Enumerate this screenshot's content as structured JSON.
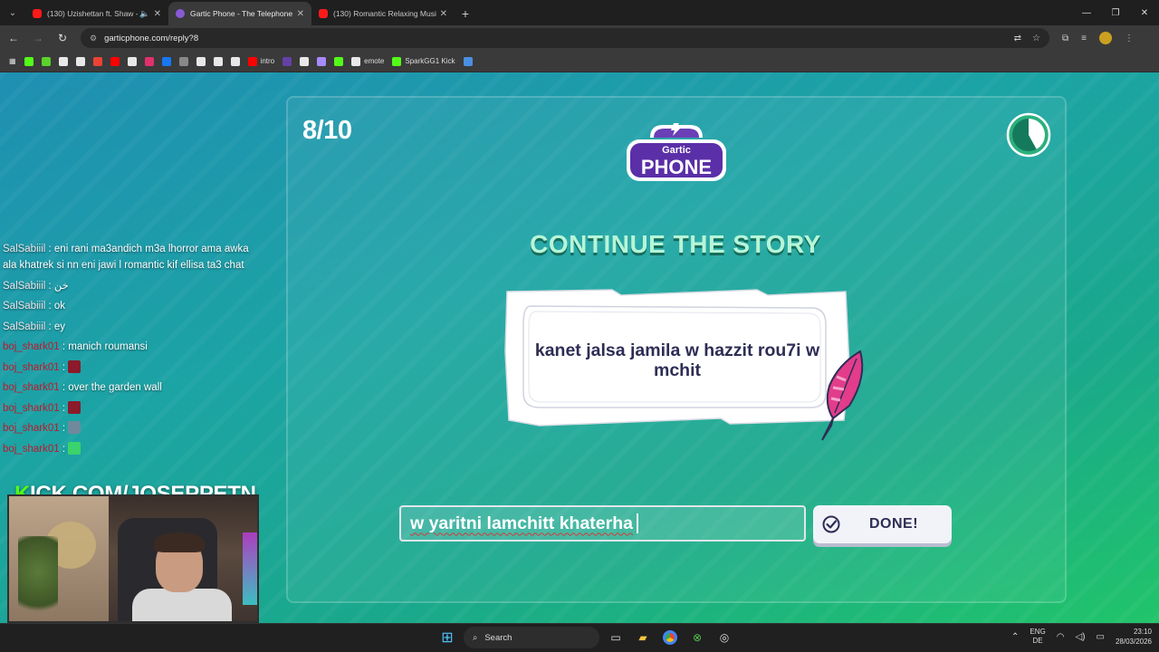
{
  "browser": {
    "tabs": [
      {
        "title": "(130) Uzishettan ft. Shaw - ",
        "favicon": "youtube-icon",
        "audio": true,
        "active": false
      },
      {
        "title": "Gartic Phone - The Telephone G",
        "favicon": "gartic-icon",
        "audio": false,
        "active": true
      },
      {
        "title": "(130) Romantic Relaxing Music",
        "favicon": "youtube-icon",
        "audio": false,
        "active": false
      }
    ],
    "url": "garticphone.com/reply?8",
    "bookmarks": [
      {
        "label": "",
        "icon": "kick-icon",
        "color": "#53fc18"
      },
      {
        "label": "",
        "icon": "d-icon",
        "color": "#5bd12b"
      },
      {
        "label": "",
        "icon": "diamond-icon",
        "color": "#e8e8e8"
      },
      {
        "label": "",
        "icon": "download-icon",
        "color": "#e8e8e8"
      },
      {
        "label": "",
        "icon": "gmail-icon",
        "color": "#ea4335"
      },
      {
        "label": "",
        "icon": "youtube-icon",
        "color": "#ff0000"
      },
      {
        "label": "",
        "icon": "tiktok-icon",
        "color": "#e8e8e8"
      },
      {
        "label": "",
        "icon": "instagram-icon",
        "color": "#e1306c"
      },
      {
        "label": "",
        "icon": "facebook-icon",
        "color": "#1877f2"
      },
      {
        "label": "",
        "icon": "gamepad-icon",
        "color": "#888888"
      },
      {
        "label": "",
        "icon": "star-icon",
        "color": "#e8e8e8"
      },
      {
        "label": "",
        "icon": "camera-icon",
        "color": "#e8e8e8"
      },
      {
        "label": "",
        "icon": "document-icon",
        "color": "#e8e8e8"
      },
      {
        "label": "intro",
        "icon": "youtube-icon",
        "color": "#ff0000"
      },
      {
        "label": "",
        "icon": "v-icon",
        "color": "#6441a5"
      },
      {
        "label": "",
        "icon": "p-icon",
        "color": "#e8e8e8"
      },
      {
        "label": "",
        "icon": "discord-icon",
        "color": "#a78bfa"
      },
      {
        "label": "",
        "icon": "circle-icon",
        "color": "#53fc18"
      },
      {
        "label": "emote",
        "icon": "emote-icon",
        "color": "#e8e8e8"
      },
      {
        "label": "SparkGG1 Kick",
        "icon": "kick-icon",
        "color": "#53fc18"
      },
      {
        "label": "",
        "icon": "meta-icon",
        "color": "#4a90e2"
      }
    ]
  },
  "game": {
    "round": "8/10",
    "logo_top": "Gartic",
    "logo_bottom": "PHONE",
    "headline": "CONTINUE THE STORY",
    "story": "kanet jalsa jamila w hazzit rou7i w mchit",
    "answer_value": "w yaritni lamchitt khaterha",
    "done_label": "DONE!",
    "timer_progress": 0.42
  },
  "stream": {
    "chat": [
      {
        "user": "SalSabiiil",
        "user_color": "light",
        "text": " : eni rani ma3andich m3a lhorror ama awka ala khatrek si nn eni jawi l romantic kif ellisa ta3 chat",
        "emote": ""
      },
      {
        "user": "SalSabiiil",
        "user_color": "light",
        "text": " : خن",
        "emote": ""
      },
      {
        "user": "SalSabiiil",
        "user_color": "light",
        "text": " : ok",
        "emote": ""
      },
      {
        "user": "SalSabiiil",
        "user_color": "light",
        "text": " : ey",
        "emote": ""
      },
      {
        "user": "boj_shark01",
        "user_color": "red",
        "text": " : manich roumansi",
        "emote": ""
      },
      {
        "user": "boj_shark01",
        "user_color": "red",
        "text": " : ",
        "emote": "#8b1a2a"
      },
      {
        "user": "boj_shark01",
        "user_color": "red",
        "text": " : over the garden wall",
        "emote": ""
      },
      {
        "user": "boj_shark01",
        "user_color": "red",
        "text": " : ",
        "emote": "#8b1a2a"
      },
      {
        "user": "boj_shark01",
        "user_color": "red",
        "text": " : ",
        "emote": "#6f8a9c"
      },
      {
        "user": "boj_shark01",
        "user_color": "red",
        "text": " : ",
        "emote": "#3bd36b"
      }
    ],
    "kick_banner_k": "K",
    "kick_banner_rest": "ICK.COM/JOSEPPETN"
  },
  "taskbar": {
    "search_label": "Search",
    "lang_top": "ENG",
    "lang_bottom": "DE",
    "time": "23:10",
    "date": "28/03/2026"
  }
}
